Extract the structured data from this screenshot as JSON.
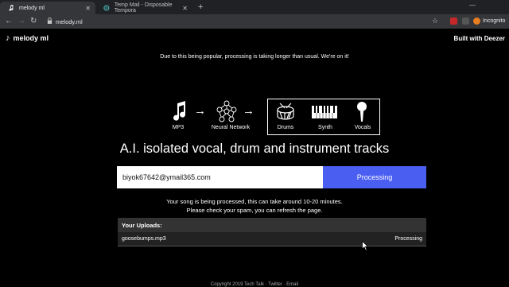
{
  "browser": {
    "tabs": [
      {
        "title": "melody ml",
        "active": true
      },
      {
        "title": "Temp Mail - Disposable Tempora",
        "active": false
      }
    ],
    "url": "melody.ml",
    "incognito_label": "Incognito"
  },
  "header": {
    "brand": "melody ml",
    "built_with": "Built with Deezer"
  },
  "notice": "Due to this being popular, processing is taking longer than usual. We're on it!",
  "diagram": {
    "input_label": "MP3",
    "network_label": "Neural Network",
    "stems": [
      "Drums",
      "Synth",
      "Vocals"
    ]
  },
  "headline": "A.I. isolated vocal, drum and instrument tracks",
  "form": {
    "email_value": "biyok67642@ymail365.com",
    "submit_label": "Processing"
  },
  "status": {
    "line1": "Your song is being processed, this can take around 10-20 minutes.",
    "line2": "Please check your spam, you can refresh the page."
  },
  "uploads": {
    "title": "Your Uploads:",
    "items": [
      {
        "file": "goosebumps.mp3",
        "status": "Processing"
      }
    ]
  },
  "footer": "Copyright 2019 Tech Talk · Twitter · Email",
  "colors": {
    "accent": "#4a5ef2",
    "background": "#000000",
    "chrome_dark": "#202124"
  }
}
